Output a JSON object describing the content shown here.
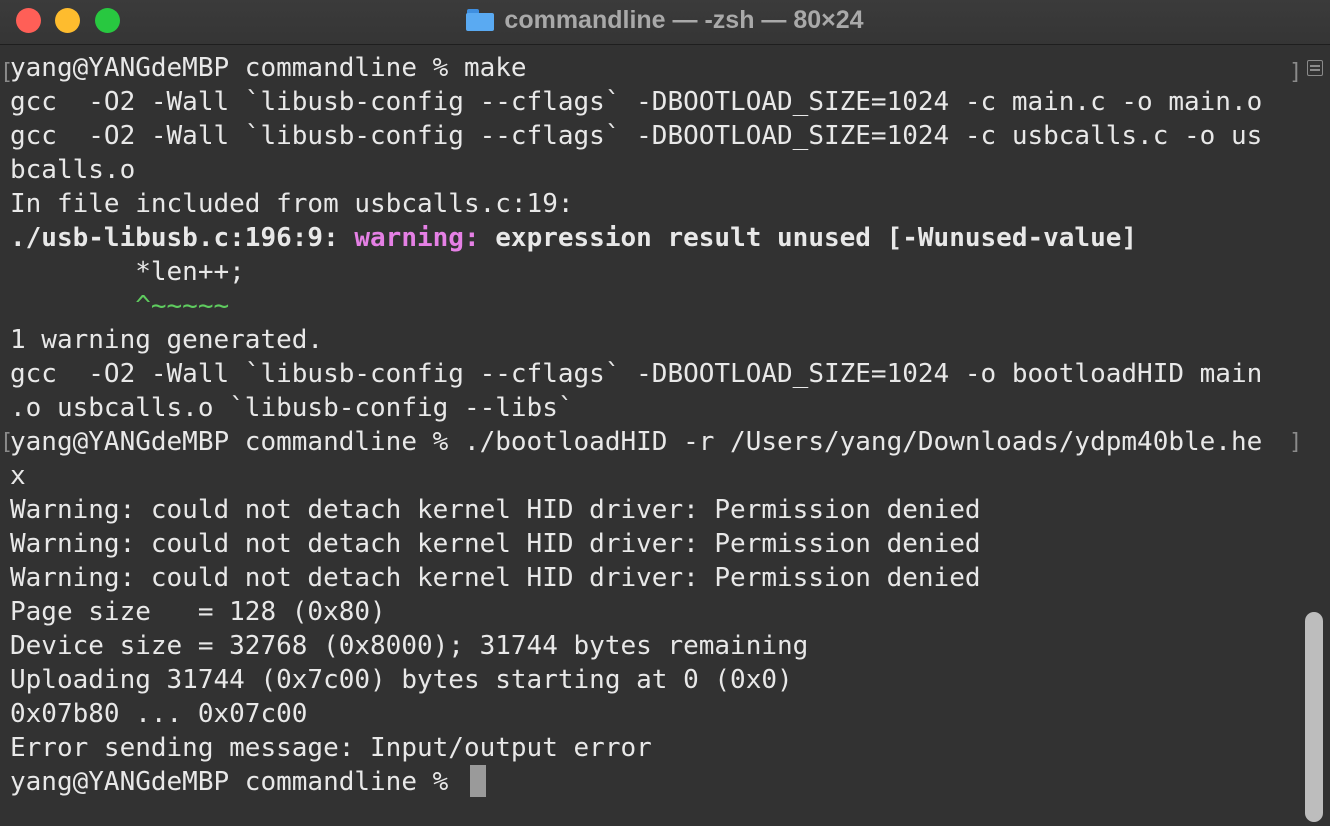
{
  "window": {
    "title": "commandline — -zsh — 80×24",
    "folder_icon": "folder-icon"
  },
  "terminal": {
    "lines": [
      {
        "text": "yang@YANGdeMBP commandline % make"
      },
      {
        "text": "gcc  -O2 -Wall `libusb-config --cflags` -DBOOTLOAD_SIZE=1024 -c main.c -o main.o"
      },
      {
        "text": "gcc  -O2 -Wall `libusb-config --cflags` -DBOOTLOAD_SIZE=1024 -c usbcalls.c -o us"
      },
      {
        "text": "bcalls.o"
      },
      {
        "text": "In file included from usbcalls.c:19:"
      },
      {
        "prefix": "./usb-libusb.c:196:9: ",
        "warning": "warning:",
        "message": " expression result unused [-Wunused-value]"
      },
      {
        "text": "        *len++;"
      },
      {
        "text": "        ^~~~~~"
      },
      {
        "text": "1 warning generated."
      },
      {
        "text": "gcc  -O2 -Wall `libusb-config --cflags` -DBOOTLOAD_SIZE=1024 -o bootloadHID main"
      },
      {
        "text": ".o usbcalls.o `libusb-config --libs`"
      },
      {
        "text": "yang@YANGdeMBP commandline % ./bootloadHID -r /Users/yang/Downloads/ydpm40ble.he"
      },
      {
        "text": "x"
      },
      {
        "text": "Warning: could not detach kernel HID driver: Permission denied"
      },
      {
        "text": "Warning: could not detach kernel HID driver: Permission denied"
      },
      {
        "text": "Warning: could not detach kernel HID driver: Permission denied"
      },
      {
        "text": "Page size   = 128 (0x80)"
      },
      {
        "text": "Device size = 32768 (0x8000); 31744 bytes remaining"
      },
      {
        "text": "Uploading 31744 (0x7c00) bytes starting at 0 (0x0)"
      },
      {
        "text": "0x07b80 ... 0x07c00"
      },
      {
        "text": "Error sending message: Input/output error"
      },
      {
        "text": "yang@YANGdeMBP commandline % "
      }
    ]
  },
  "colors": {
    "background": "#323232",
    "text": "#e8e8e8",
    "warning": "#e580e5",
    "caret": "#5fcc5f",
    "close": "#ff5f57",
    "minimize": "#febc2e",
    "maximize": "#28c840"
  }
}
